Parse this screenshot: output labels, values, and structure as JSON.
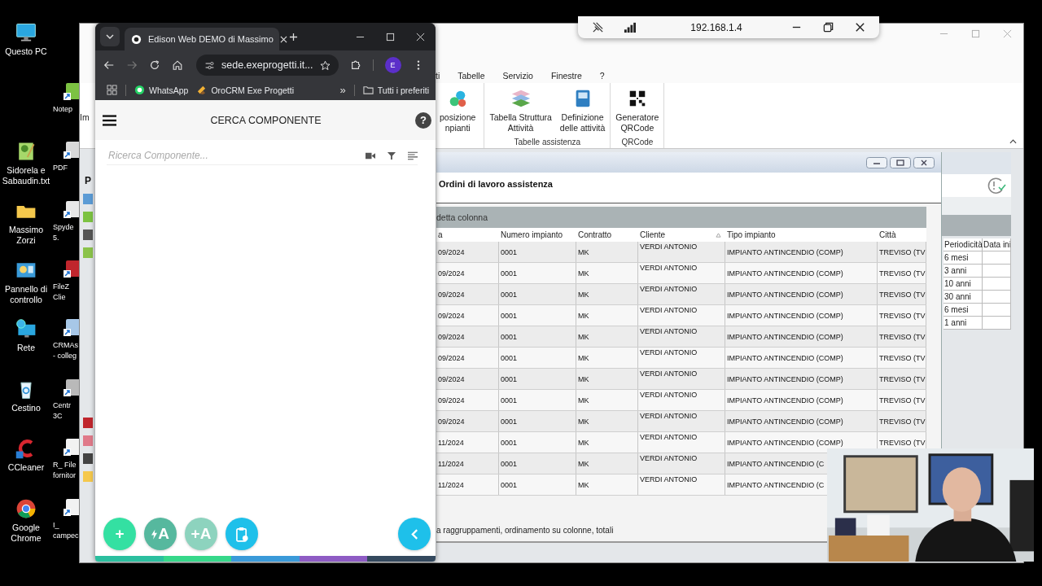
{
  "desktop_icons": [
    {
      "kind": "computer",
      "lines": [
        "Questo PC"
      ]
    },
    {
      "kind": "textfile",
      "lines": [
        "Sidorela e",
        "Sabaudin.txt"
      ]
    },
    {
      "kind": "folder",
      "lines": [
        "Massimo",
        "Zorzi"
      ]
    },
    {
      "kind": "controlpanel",
      "lines": [
        "Pannello di",
        "controllo"
      ]
    },
    {
      "kind": "network",
      "lines": [
        "Rete"
      ]
    },
    {
      "kind": "recycle",
      "lines": [
        "Cestino"
      ]
    },
    {
      "kind": "cleaner",
      "lines": [
        "CCleaner"
      ]
    },
    {
      "kind": "browser",
      "lines": [
        "Google",
        "Chrome"
      ]
    }
  ],
  "desktop_shortcuts": [
    {
      "kind": "notepad",
      "lines": [
        "Notep"
      ]
    },
    {
      "kind": "pdf",
      "lines": [
        "PDF"
      ]
    },
    {
      "kind": "spyder",
      "lines": [
        "Spyde",
        "5."
      ]
    },
    {
      "kind": "filezilla",
      "lines": [
        "FileZ",
        "Clie"
      ]
    },
    {
      "kind": "server",
      "lines": [
        "CRMAs",
        "- colleg"
      ]
    },
    {
      "kind": "phone",
      "lines": [
        "Centr",
        "3C"
      ]
    },
    {
      "kind": "mail",
      "lines": [
        "R_ File",
        "fornitor"
      ]
    },
    {
      "kind": "mail",
      "lines": [
        "I_",
        "campec"
      ]
    }
  ],
  "remote_bar": {
    "address": "192.168.1.4"
  },
  "erp": {
    "ribbon_fragment": "Im",
    "strip_label": "P",
    "menu": [
      "ti",
      "Tabelle",
      "Servizio",
      "Finestre",
      "?"
    ],
    "cut_button": {
      "kind": "molecule",
      "lines": [
        "posizione",
        "npianti"
      ]
    },
    "ribbon_groups": [
      {
        "label": "Tabelle assistenza",
        "buttons": [
          {
            "kind": "layers",
            "lines": [
              "Tabella Struttura",
              "Attività"
            ]
          },
          {
            "kind": "book",
            "lines": [
              "Definizione",
              "delle attività"
            ]
          }
        ]
      },
      {
        "label": "QRCode",
        "buttons": [
          {
            "kind": "qr",
            "lines": [
              "Generatore",
              "QRCode"
            ]
          }
        ]
      }
    ],
    "child": {
      "title": "Ordini di lavoro assistenza",
      "group_hint": "detta colonna",
      "columns": [
        {
          "label": "a",
          "sorted": false
        },
        {
          "label": "Numero impianto",
          "sorted": false
        },
        {
          "label": "Contratto",
          "sorted": false
        },
        {
          "label": "Cliente",
          "sorted": true
        },
        {
          "label": "Tipo impianto",
          "sorted": false
        },
        {
          "label": "Città",
          "sorted": false
        }
      ],
      "rows": [
        [
          "09/2024",
          "0001",
          "MK",
          "VERDI ANTONIO",
          "IMPIANTO ANTINCENDIO (COMP)",
          "TREVISO (TV"
        ],
        [
          "09/2024",
          "0001",
          "MK",
          "VERDI ANTONIO",
          "IMPIANTO ANTINCENDIO (COMP)",
          "TREVISO (TV"
        ],
        [
          "09/2024",
          "0001",
          "MK",
          "VERDI ANTONIO",
          "IMPIANTO ANTINCENDIO (COMP)",
          "TREVISO (TV"
        ],
        [
          "09/2024",
          "0001",
          "MK",
          "VERDI ANTONIO",
          "IMPIANTO ANTINCENDIO (COMP)",
          "TREVISO (TV"
        ],
        [
          "09/2024",
          "0001",
          "MK",
          "VERDI ANTONIO",
          "IMPIANTO ANTINCENDIO (COMP)",
          "TREVISO (TV"
        ],
        [
          "09/2024",
          "0001",
          "MK",
          "VERDI ANTONIO",
          "IMPIANTO ANTINCENDIO (COMP)",
          "TREVISO (TV"
        ],
        [
          "09/2024",
          "0001",
          "MK",
          "VERDI ANTONIO",
          "IMPIANTO ANTINCENDIO (COMP)",
          "TREVISO (TV"
        ],
        [
          "09/2024",
          "0001",
          "MK",
          "VERDI ANTONIO",
          "IMPIANTO ANTINCENDIO (COMP)",
          "TREVISO (TV"
        ],
        [
          "09/2024",
          "0001",
          "MK",
          "VERDI ANTONIO",
          "IMPIANTO ANTINCENDIO (COMP)",
          "TREVISO (TV"
        ],
        [
          "11/2024",
          "0001",
          "MK",
          "VERDI ANTONIO",
          "IMPIANTO ANTINCENDIO (COMP)",
          "TREVISO (TV"
        ],
        [
          "11/2024",
          "0001",
          "MK",
          "VERDI ANTONIO",
          "IMPIANTO ANTINCENDIO (C"
        ],
        [
          "11/2024",
          "0001",
          "MK",
          "VERDI ANTONIO",
          "IMPIANTO ANTINCENDIO (C"
        ]
      ],
      "footer": "a raggruppamenti, ordinamento su colonne, totali"
    },
    "side_table": {
      "columns": [
        "Periodicità",
        "Data ini"
      ],
      "rows": [
        "6 mesi",
        "3 anni",
        "10 anni",
        "30 anni",
        "6 mesi",
        "1 anni"
      ]
    }
  },
  "browser": {
    "tab": {
      "title": "Edison Web DEMO di Massimo"
    },
    "url": "sede.exeprogetti.it...",
    "forward_disabled": true,
    "profile": "E",
    "bookmarks": [
      {
        "kind": "whatsapp",
        "label": "WhatsApp"
      },
      {
        "kind": "orocrm",
        "label": "OroCRM Exe Progetti"
      }
    ],
    "bookmarks_more": "»",
    "all_bookmarks": "Tutti i preferiti"
  },
  "app": {
    "title": "CERCA COMPONENTE",
    "help": "?",
    "search_placeholder": "Ricerca Componente...",
    "fabs": [
      {
        "kind": "text",
        "label": "+",
        "color": "#34e0a2"
      },
      {
        "kind": "bolt",
        "label": "A",
        "color": "#56b89e"
      },
      {
        "kind": "text",
        "label": "+A",
        "color": "#8dd3be"
      },
      {
        "kind": "clipboard",
        "color": "#1ec0ea"
      }
    ]
  }
}
